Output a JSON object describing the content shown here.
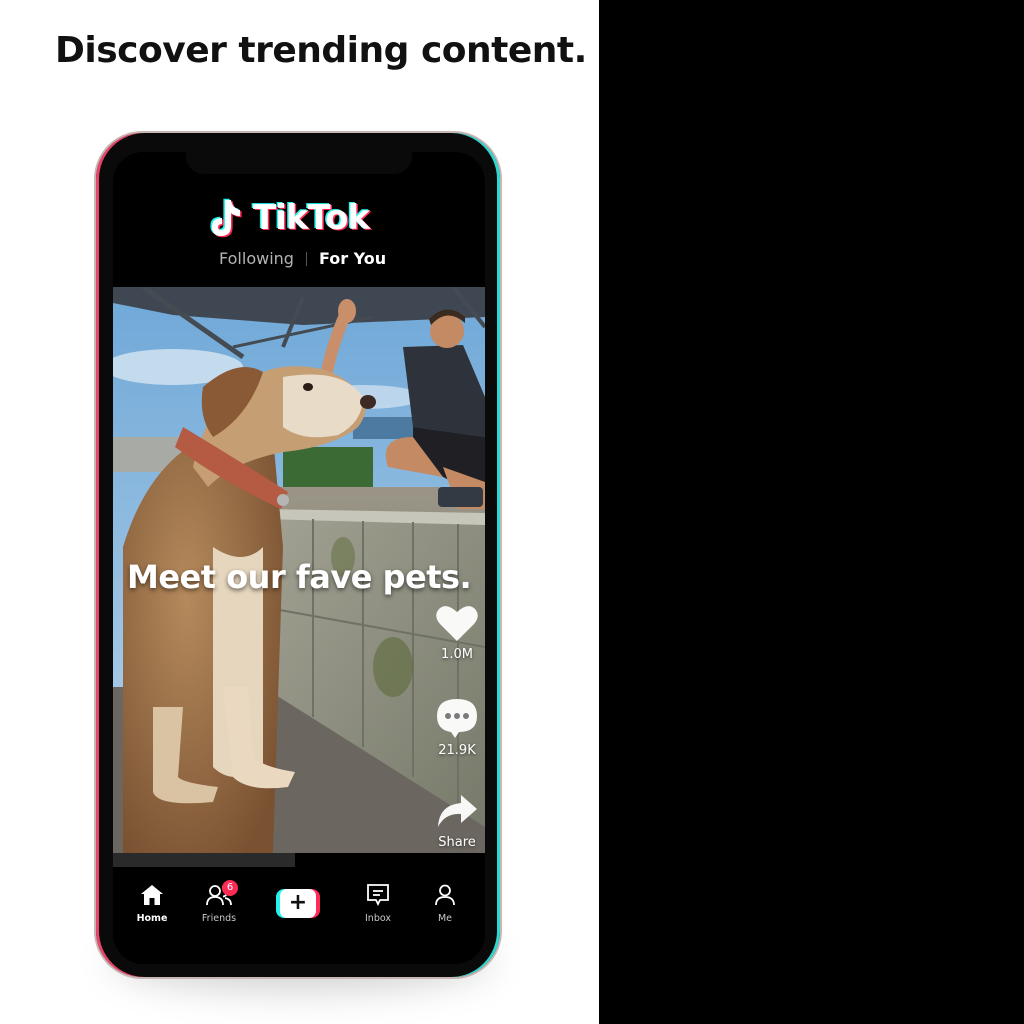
{
  "headline": "Discover trending content.",
  "app": {
    "name": "TikTok",
    "logo_icon": "tiktok-note-icon"
  },
  "feed_tabs": {
    "following": "Following",
    "for_you": "For You",
    "active": "For You"
  },
  "video": {
    "caption": "Meet our fave pets.",
    "actions": {
      "likes": {
        "icon": "heart-icon",
        "count": "1.0M"
      },
      "comments": {
        "icon": "comment-bubble-icon",
        "count": "21.9K"
      },
      "share": {
        "icon": "share-arrow-icon",
        "label": "Share"
      }
    },
    "progress": 0.49
  },
  "bottom_nav": {
    "home": {
      "label": "Home",
      "icon": "house-icon"
    },
    "friends": {
      "label": "Friends",
      "icon": "friends-icon",
      "badge": "6"
    },
    "create": {
      "symbol": "+",
      "icon": "plus-icon"
    },
    "inbox": {
      "label": "Inbox",
      "icon": "inbox-icon"
    },
    "me": {
      "label": "Me",
      "icon": "person-icon"
    }
  },
  "colors": {
    "brand_cyan": "#25f4ee",
    "brand_red": "#fe2c55",
    "background_dark": "#000000",
    "badge": "#fe2c55"
  }
}
